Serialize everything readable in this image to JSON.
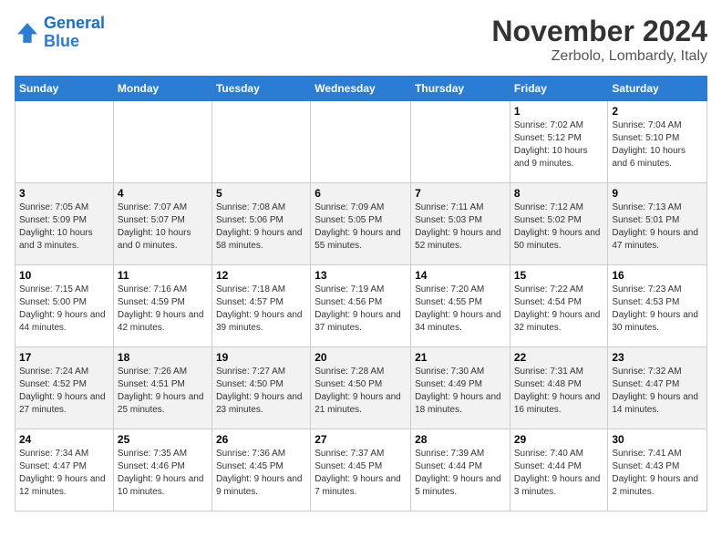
{
  "header": {
    "logo_line1": "General",
    "logo_line2": "Blue",
    "month_title": "November 2024",
    "location": "Zerbolo, Lombardy, Italy"
  },
  "weekdays": [
    "Sunday",
    "Monday",
    "Tuesday",
    "Wednesday",
    "Thursday",
    "Friday",
    "Saturday"
  ],
  "weeks": [
    [
      {
        "day": "",
        "info": ""
      },
      {
        "day": "",
        "info": ""
      },
      {
        "day": "",
        "info": ""
      },
      {
        "day": "",
        "info": ""
      },
      {
        "day": "",
        "info": ""
      },
      {
        "day": "1",
        "info": "Sunrise: 7:02 AM\nSunset: 5:12 PM\nDaylight: 10 hours and 9 minutes."
      },
      {
        "day": "2",
        "info": "Sunrise: 7:04 AM\nSunset: 5:10 PM\nDaylight: 10 hours and 6 minutes."
      }
    ],
    [
      {
        "day": "3",
        "info": "Sunrise: 7:05 AM\nSunset: 5:09 PM\nDaylight: 10 hours and 3 minutes."
      },
      {
        "day": "4",
        "info": "Sunrise: 7:07 AM\nSunset: 5:07 PM\nDaylight: 10 hours and 0 minutes."
      },
      {
        "day": "5",
        "info": "Sunrise: 7:08 AM\nSunset: 5:06 PM\nDaylight: 9 hours and 58 minutes."
      },
      {
        "day": "6",
        "info": "Sunrise: 7:09 AM\nSunset: 5:05 PM\nDaylight: 9 hours and 55 minutes."
      },
      {
        "day": "7",
        "info": "Sunrise: 7:11 AM\nSunset: 5:03 PM\nDaylight: 9 hours and 52 minutes."
      },
      {
        "day": "8",
        "info": "Sunrise: 7:12 AM\nSunset: 5:02 PM\nDaylight: 9 hours and 50 minutes."
      },
      {
        "day": "9",
        "info": "Sunrise: 7:13 AM\nSunset: 5:01 PM\nDaylight: 9 hours and 47 minutes."
      }
    ],
    [
      {
        "day": "10",
        "info": "Sunrise: 7:15 AM\nSunset: 5:00 PM\nDaylight: 9 hours and 44 minutes."
      },
      {
        "day": "11",
        "info": "Sunrise: 7:16 AM\nSunset: 4:59 PM\nDaylight: 9 hours and 42 minutes."
      },
      {
        "day": "12",
        "info": "Sunrise: 7:18 AM\nSunset: 4:57 PM\nDaylight: 9 hours and 39 minutes."
      },
      {
        "day": "13",
        "info": "Sunrise: 7:19 AM\nSunset: 4:56 PM\nDaylight: 9 hours and 37 minutes."
      },
      {
        "day": "14",
        "info": "Sunrise: 7:20 AM\nSunset: 4:55 PM\nDaylight: 9 hours and 34 minutes."
      },
      {
        "day": "15",
        "info": "Sunrise: 7:22 AM\nSunset: 4:54 PM\nDaylight: 9 hours and 32 minutes."
      },
      {
        "day": "16",
        "info": "Sunrise: 7:23 AM\nSunset: 4:53 PM\nDaylight: 9 hours and 30 minutes."
      }
    ],
    [
      {
        "day": "17",
        "info": "Sunrise: 7:24 AM\nSunset: 4:52 PM\nDaylight: 9 hours and 27 minutes."
      },
      {
        "day": "18",
        "info": "Sunrise: 7:26 AM\nSunset: 4:51 PM\nDaylight: 9 hours and 25 minutes."
      },
      {
        "day": "19",
        "info": "Sunrise: 7:27 AM\nSunset: 4:50 PM\nDaylight: 9 hours and 23 minutes."
      },
      {
        "day": "20",
        "info": "Sunrise: 7:28 AM\nSunset: 4:50 PM\nDaylight: 9 hours and 21 minutes."
      },
      {
        "day": "21",
        "info": "Sunrise: 7:30 AM\nSunset: 4:49 PM\nDaylight: 9 hours and 18 minutes."
      },
      {
        "day": "22",
        "info": "Sunrise: 7:31 AM\nSunset: 4:48 PM\nDaylight: 9 hours and 16 minutes."
      },
      {
        "day": "23",
        "info": "Sunrise: 7:32 AM\nSunset: 4:47 PM\nDaylight: 9 hours and 14 minutes."
      }
    ],
    [
      {
        "day": "24",
        "info": "Sunrise: 7:34 AM\nSunset: 4:47 PM\nDaylight: 9 hours and 12 minutes."
      },
      {
        "day": "25",
        "info": "Sunrise: 7:35 AM\nSunset: 4:46 PM\nDaylight: 9 hours and 10 minutes."
      },
      {
        "day": "26",
        "info": "Sunrise: 7:36 AM\nSunset: 4:45 PM\nDaylight: 9 hours and 9 minutes."
      },
      {
        "day": "27",
        "info": "Sunrise: 7:37 AM\nSunset: 4:45 PM\nDaylight: 9 hours and 7 minutes."
      },
      {
        "day": "28",
        "info": "Sunrise: 7:39 AM\nSunset: 4:44 PM\nDaylight: 9 hours and 5 minutes."
      },
      {
        "day": "29",
        "info": "Sunrise: 7:40 AM\nSunset: 4:44 PM\nDaylight: 9 hours and 3 minutes."
      },
      {
        "day": "30",
        "info": "Sunrise: 7:41 AM\nSunset: 4:43 PM\nDaylight: 9 hours and 2 minutes."
      }
    ]
  ]
}
